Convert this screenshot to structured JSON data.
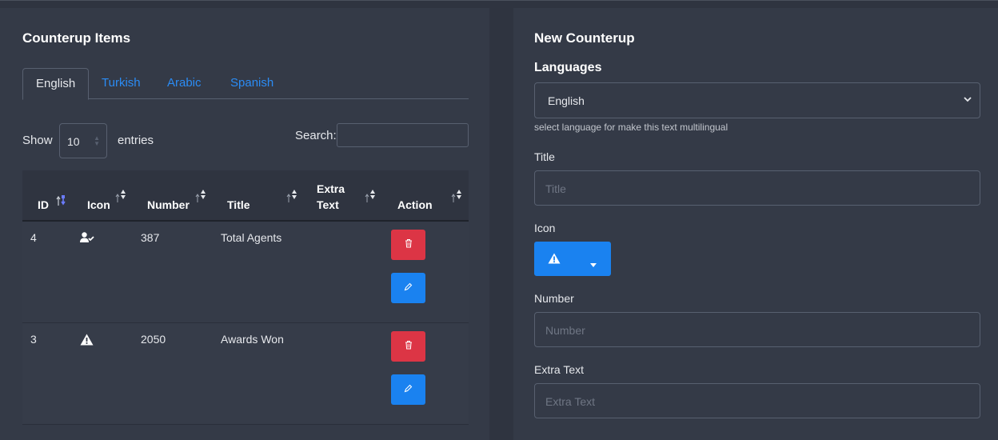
{
  "left_panel": {
    "title": "Counterup Items",
    "tabs": [
      {
        "label": "English",
        "active": true
      },
      {
        "label": "Turkish",
        "active": false
      },
      {
        "label": "Arabic",
        "active": false
      },
      {
        "label": "Spanish",
        "active": false
      }
    ],
    "show_label": "Show",
    "entries_value": "10",
    "entries_label": "entries",
    "search_label": "Search:",
    "search_value": "",
    "table": {
      "columns": [
        {
          "label": "ID"
        },
        {
          "label": "Icon"
        },
        {
          "label": "Number"
        },
        {
          "label": "Title"
        },
        {
          "label_line1": "Extra",
          "label_line2": "Text"
        },
        {
          "label": "Action"
        }
      ],
      "rows": [
        {
          "id": "4",
          "icon": "user-check-icon",
          "number": "387",
          "title": "Total Agents",
          "extra_text": ""
        },
        {
          "id": "3",
          "icon": "warning-icon",
          "number": "2050",
          "title": "Awards Won",
          "extra_text": ""
        }
      ]
    }
  },
  "right_panel": {
    "title": "New Counterup",
    "languages_label": "Languages",
    "language_selected": "English",
    "language_help": "select language for make this text multilingual",
    "title_label": "Title",
    "title_placeholder": "Title",
    "icon_label": "Icon",
    "icon_selected": "warning-icon",
    "number_label": "Number",
    "number_placeholder": "Number",
    "extra_text_label": "Extra Text",
    "extra_text_placeholder": "Extra Text"
  },
  "colors": {
    "background": "#2f3440",
    "panel": "#343a47",
    "accent_blue": "#1a82f0",
    "danger_red": "#dc3545",
    "tab_link": "#2b8cf5"
  }
}
